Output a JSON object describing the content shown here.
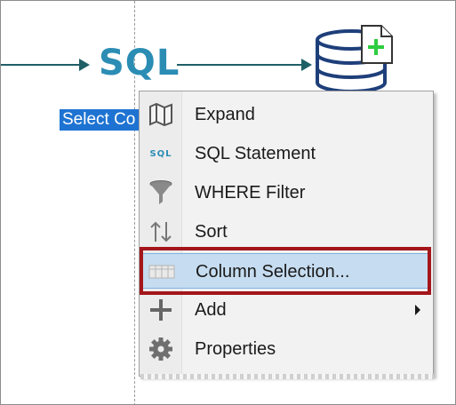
{
  "canvas": {
    "sql_node_text": "SQL",
    "node_label": "Select Co",
    "colors": {
      "connector": "#1f5f66",
      "sql_text": "#2b8db4",
      "node_label_bg": "#1e73d2",
      "database_icon": "#1e3f7a",
      "document_plus": "#2ecc40",
      "highlight_box": "#a3161b",
      "selected_item_bg": "#c6dcf0"
    }
  },
  "context_menu": {
    "items": [
      {
        "label": "Expand",
        "icon": "map-icon"
      },
      {
        "label": "SQL Statement",
        "icon": "sql-text-icon",
        "icon_text": "SQL"
      },
      {
        "label": "WHERE Filter",
        "icon": "funnel-icon"
      },
      {
        "label": "Sort",
        "icon": "sort-arrows-icon"
      },
      {
        "label": "Column Selection...",
        "icon": "columns-icon",
        "selected": true
      },
      {
        "label": "Add",
        "icon": "plus-icon",
        "has_submenu": true
      },
      {
        "label": "Properties",
        "icon": "gear-icon"
      }
    ]
  }
}
